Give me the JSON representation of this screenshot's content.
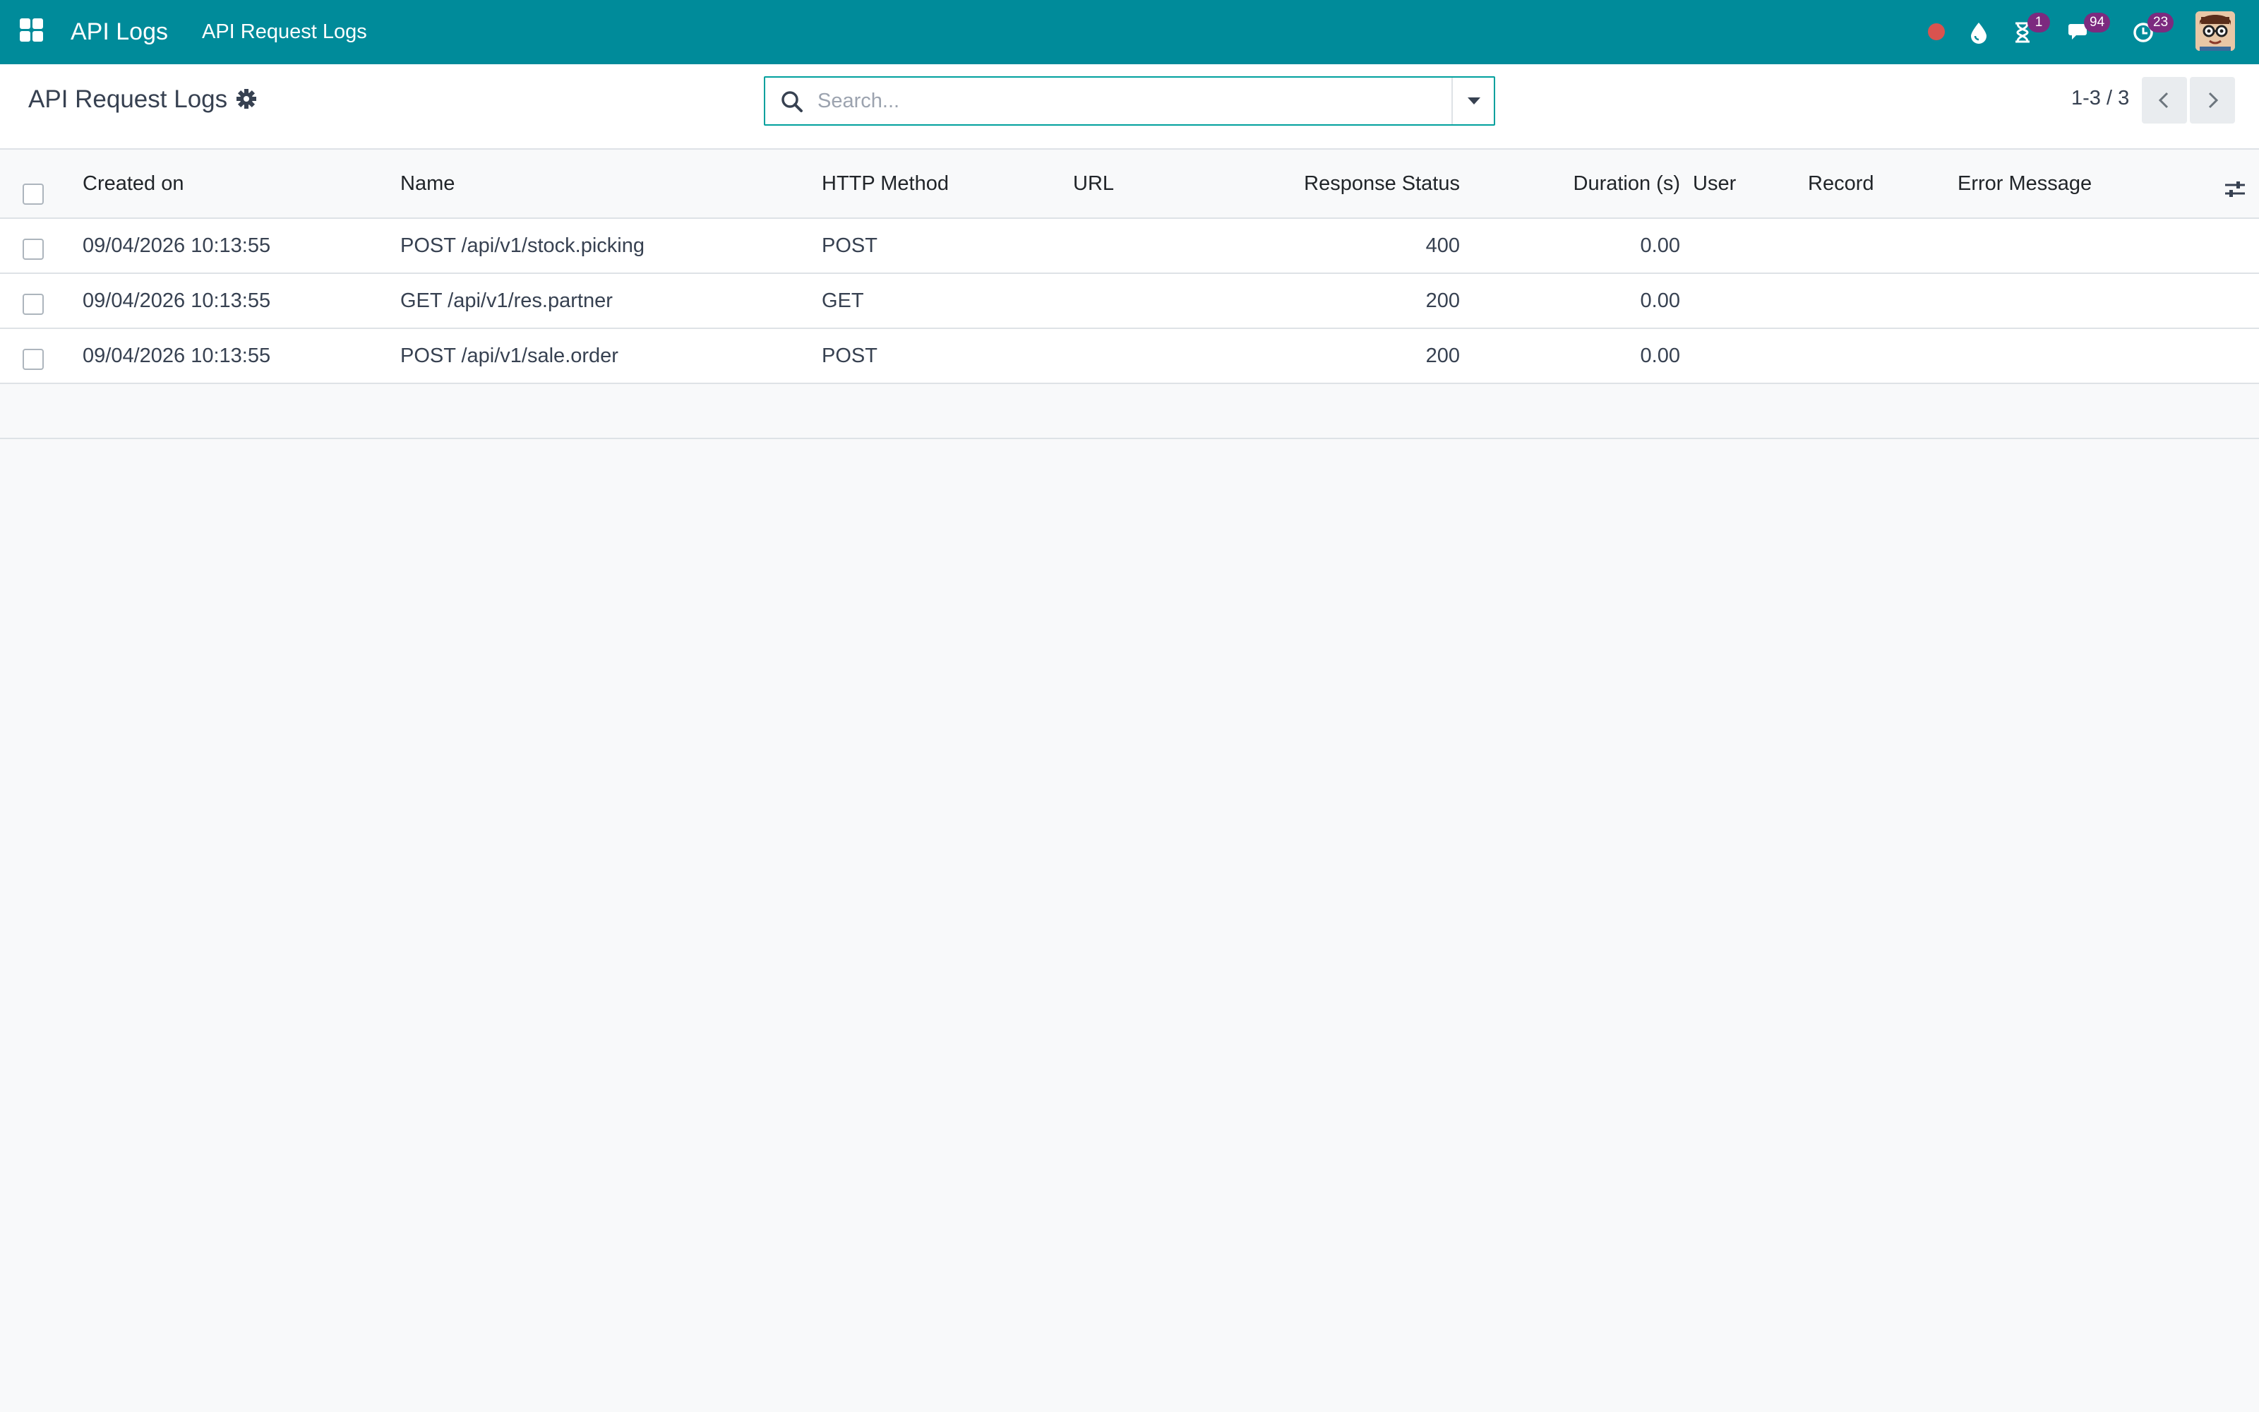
{
  "navbar": {
    "app_name": "API Logs",
    "menu_item": "API Request Logs",
    "systray": {
      "status_color": "#d9534f",
      "activities_count": "1",
      "messages_count": "94",
      "timesheet_count": "23"
    }
  },
  "control_panel": {
    "title": "API Request Logs",
    "search_placeholder": "Search...",
    "pager": "1-3 / 3"
  },
  "table": {
    "columns": [
      "Created on",
      "Name",
      "HTTP Method",
      "URL",
      "Response Status",
      "Duration (s)",
      "User",
      "Record",
      "Error Message"
    ],
    "rows": [
      {
        "created_on": "09/04/2026 10:13:55",
        "name": "POST /api/v1/stock.picking",
        "method": "POST",
        "url": "",
        "status": "400",
        "duration": "0.00",
        "user": "",
        "record": "",
        "error": ""
      },
      {
        "created_on": "09/04/2026 10:13:55",
        "name": "GET /api/v1/res.partner",
        "method": "GET",
        "url": "",
        "status": "200",
        "duration": "0.00",
        "user": "",
        "record": "",
        "error": ""
      },
      {
        "created_on": "09/04/2026 10:13:55",
        "name": "POST /api/v1/sale.order",
        "method": "POST",
        "url": "",
        "status": "200",
        "duration": "0.00",
        "user": "",
        "record": "",
        "error": ""
      }
    ]
  },
  "colors": {
    "navbar": "#008b9a",
    "badge": "#7c2a7f",
    "search_border": "#00a09d"
  }
}
